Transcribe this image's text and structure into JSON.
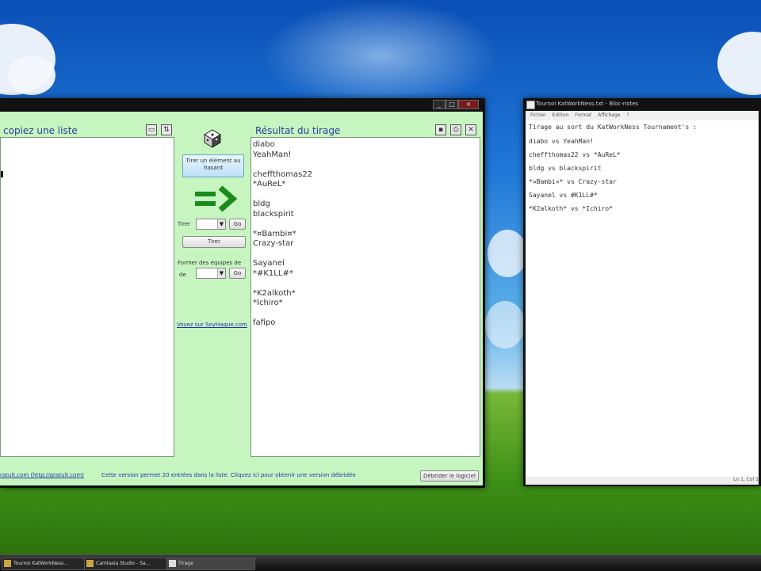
{
  "app": {
    "left_title": "copiez une liste",
    "right_title": "Résultat du tirage",
    "results": [
      "diabo",
      "YeahMan!",
      "",
      "cheffthomas22",
      "*AuReL*",
      "",
      "bldg",
      "blackspirit",
      "",
      "*¤Bambi¤*",
      "Crazy-star",
      "",
      "Sayanel",
      "*#K1LL#*",
      "",
      "*K2alkoth*",
      "*Ichiro*",
      "",
      "fafipo"
    ],
    "pick_random_button": "Tirer un élément au hasard",
    "tirer_label": "Tirer",
    "go_label": "Go",
    "tirer_button": "Tirer",
    "teams_label": "Former des équipes de",
    "site_link": "Voyez sur SoyHaque.com",
    "footer_link": "ratuit.com (http://gratuit.com)",
    "footer_note": "Cette version permet 20 entrées dans la liste. Cliquez ici pour obtenir une version débridée",
    "unlock_button": "Débrider le logiciel"
  },
  "notepad": {
    "title": "Tournoi KatWorkNess.txt - Bloc-notes",
    "menu": [
      "Fichier",
      "Edition",
      "Format",
      "Affichage",
      "?"
    ],
    "lines": [
      "Tirage au sort du KatWorkNess Tournament's :",
      "diabo vs YeahMan!",
      "cheffthomas22 vs *AuReL*",
      "bldg vs blackspirit",
      "*¤Bambi¤* vs Crazy-star",
      "Sayanel vs #K1LL#*",
      "*K2alkoth* vs *Ichiro*"
    ],
    "status": "Ln 1, Col 1"
  },
  "taskbar": {
    "items": [
      "Tournoi KatWorkNess...",
      "Camtasia Studio - Sa...",
      "Tirage"
    ]
  },
  "colors": {
    "panel_bg": "#c6f5c0",
    "title_blue": "#2e3c9c",
    "arrow_green": "#1a8a1a"
  }
}
